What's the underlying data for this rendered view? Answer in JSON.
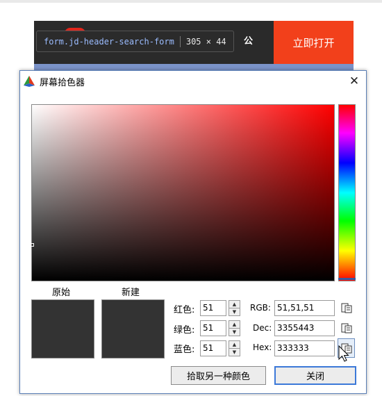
{
  "background_page": {
    "open_app_label": "立即打开",
    "devtools_tooltip": {
      "selector": "form.jd-header-search-form",
      "size": "305 × 44",
      "trailing_text": "公"
    }
  },
  "dialog": {
    "title": "屏幕拾色器",
    "icon": "color-picker-app-icon",
    "close_glyph": "✕",
    "labels": {
      "original": "原始",
      "new": "新建"
    },
    "channels": [
      {
        "label": "红色:",
        "value": "51"
      },
      {
        "label": "绿色:",
        "value": "51"
      },
      {
        "label": "蓝色:",
        "value": "51"
      }
    ],
    "formats": [
      {
        "label": "RGB:",
        "value": "51,51,51"
      },
      {
        "label": "Dec:",
        "value": "3355443"
      },
      {
        "label": "Hex:",
        "value": "333333"
      }
    ],
    "buttons": {
      "pick_again": "拾取另一种颜色",
      "close": "关闭"
    },
    "colors": {
      "original_swatch": "#333333",
      "new_swatch": "#333333",
      "hue": "#ff0000"
    }
  }
}
